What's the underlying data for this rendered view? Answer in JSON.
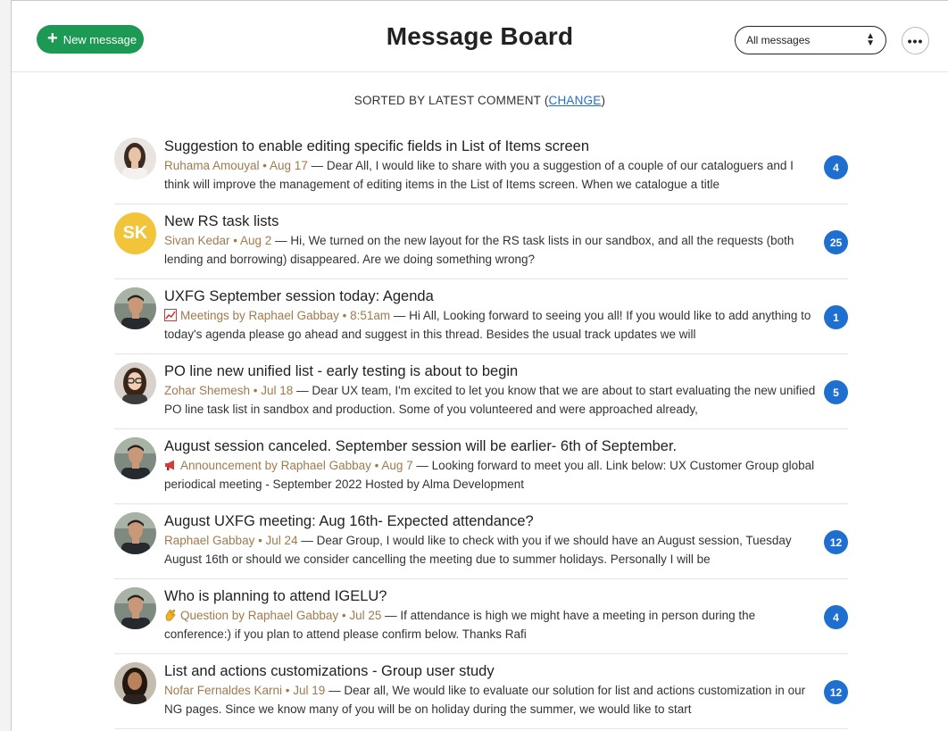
{
  "header": {
    "new_message_label": "New message",
    "title": "Message Board",
    "filter_selected": "All messages"
  },
  "sort": {
    "prefix": "SORTED BY LATEST COMMENT (",
    "change_label": "CHANGE",
    "suffix": ")"
  },
  "colors": {
    "accent_green": "#1c9a54",
    "badge_blue": "#1f6fd1",
    "meta_brown": "#a07a4e",
    "avatar_yellow": "#f2c43a"
  },
  "messages": [
    {
      "subject": "Suggestion to enable editing specific fields in List of Items screen",
      "meta": "Ruhama Amouyal • Aug 17",
      "body": " — Dear All, I would like to share with you a suggestion of a couple of our cataloguers and I think will improve the management of editing items in the List of Items screen. When we catalogue a title",
      "count": "4",
      "avatar": "photo-woman-light",
      "icon": ""
    },
    {
      "subject": "New RS task lists",
      "meta": "Sivan Kedar • Aug 2",
      "body": " — Hi, We turned on the new layout for the RS task lists in our sandbox, and all the requests (both lending and borrowing) disappeared. Are we doing something wrong?",
      "count": "25",
      "avatar": "initials",
      "initials": "SK",
      "icon": ""
    },
    {
      "subject": "UXFG September session today: Agenda",
      "meta": "Meetings by Raphael Gabbay • 8:51am",
      "body": " — Hi All,  Looking forward to seeing you all! If you would like to add anything to today's agenda please go ahead and suggest in this thread. Besides the usual track updates we will",
      "count": "1",
      "avatar": "photo-man",
      "icon": "chart-icon"
    },
    {
      "subject": "PO line new unified list - early testing is about to begin",
      "meta": "Zohar Shemesh • Jul 18",
      "body": " — Dear UX team,  I'm excited to let you know that we are about to start evaluating the new unified PO line task list in sandbox and production. Some of you volunteered and were approached already,",
      "count": "5",
      "avatar": "photo-woman-glasses",
      "icon": ""
    },
    {
      "subject": "August session canceled. September session will be earlier- 6th of September.",
      "meta": "Announcement by Raphael Gabbay • Aug 7",
      "body": " — Looking forward to meet you all. Link below: UX Customer Group global periodical meeting - September 2022 Hosted by Alma Development",
      "count": "",
      "avatar": "photo-man",
      "icon": "megaphone-icon"
    },
    {
      "subject": "August UXFG meeting: Aug 16th- Expected attendance?",
      "meta": "Raphael Gabbay • Jul 24",
      "body": " — Dear Group,  I would like to check with you if we should have an August session, Tuesday August 16th or should we consider cancelling the meeting due to summer holidays. Personally I will be",
      "count": "12",
      "avatar": "photo-man",
      "icon": ""
    },
    {
      "subject": "Who is planning to attend IGELU?",
      "meta": "Question by Raphael Gabbay • Jul 25",
      "body": " — If attendance is high we might have a meeting in person during the conference:) if you plan to attend please confirm below. Thanks Rafi",
      "count": "4",
      "avatar": "photo-man",
      "icon": "wave-hand-icon"
    },
    {
      "subject": "List and actions customizations - Group user study",
      "meta": "Nofar Fernaldes Karni • Jul 19",
      "body": " — Dear all, We would like to evaluate our solution for list and actions customization in our NG pages. Since we know many of you will be on holiday during the summer, we would like to start",
      "count": "12",
      "avatar": "photo-woman-dark",
      "icon": ""
    }
  ]
}
